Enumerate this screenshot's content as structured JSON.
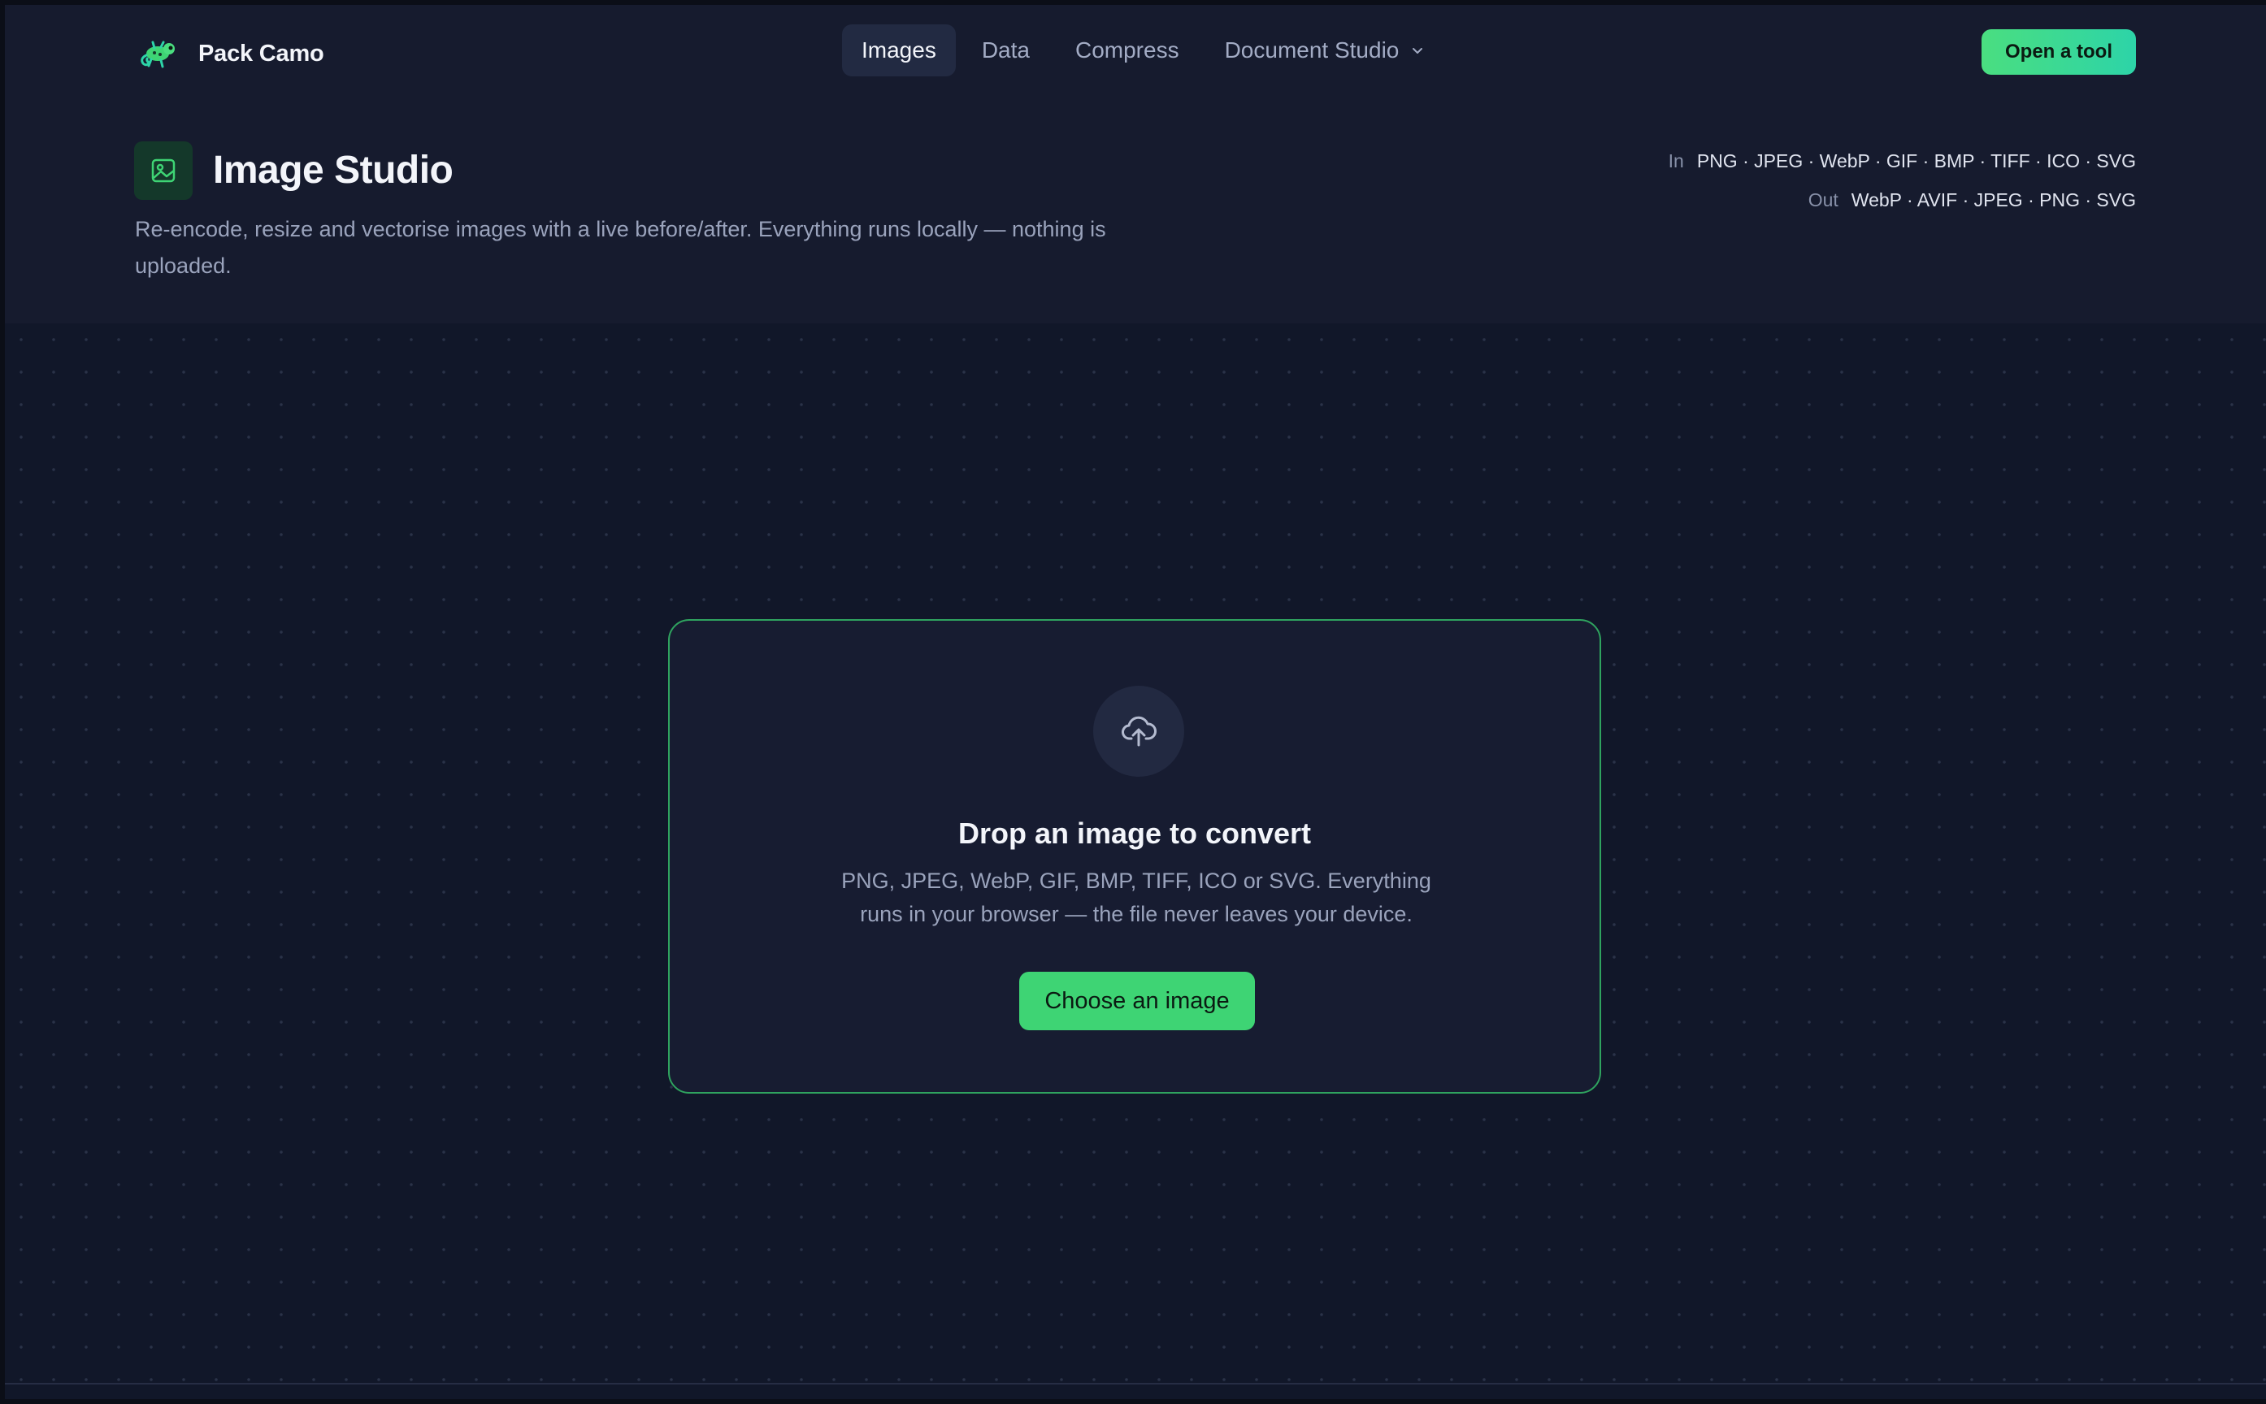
{
  "nav": {
    "brand": "Pack Camo",
    "links": [
      {
        "label": "Images",
        "active": true
      },
      {
        "label": "Data",
        "active": false
      },
      {
        "label": "Compress",
        "active": false
      },
      {
        "label": "Document Studio",
        "active": false,
        "icon": "chevron-down-icon"
      }
    ],
    "cta_label": "Open a tool"
  },
  "header": {
    "icon": "image-icon",
    "title": "Image Studio",
    "subtitle": "Re-encode, resize and vectorise images with a live before/after. Everything runs locally — nothing is uploaded.",
    "formats_in_label": "In",
    "formats_in": "PNG · JPEG · WebP · GIF · BMP · TIFF · ICO · SVG",
    "formats_out_label": "Out",
    "formats_out": "WebP · AVIF · JPEG · PNG · SVG"
  },
  "dropzone": {
    "icon": "cloud-upload-icon",
    "title": "Drop an image to convert",
    "description": "PNG, JPEG, WebP, GIF, BMP, TIFF, ICO or SVG. Everything runs in your browser — the file never leaves your device.",
    "button_label": "Choose an image"
  },
  "colors": {
    "accent": "#3ed474",
    "cta_gradient_start": "#4ade80",
    "cta_gradient_end": "#2dd4a8",
    "background": "#111729",
    "panel": "#161b2e",
    "dropzone_border": "#2fa35f"
  }
}
